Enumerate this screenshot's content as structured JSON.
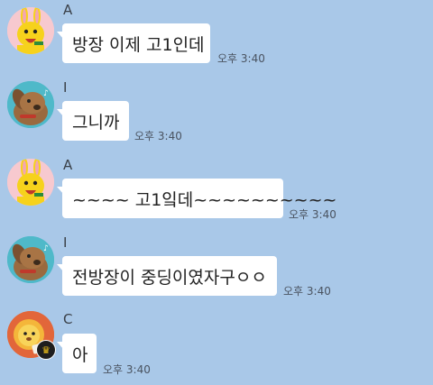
{
  "messages": [
    {
      "sender": "A",
      "text": "방장 이제 고1인데",
      "time": "오후 3:40",
      "avatar": "yellow-rabbit-icon"
    },
    {
      "sender": "I",
      "text": "그니까",
      "time": "오후 3:40",
      "avatar": "brown-dog-icon"
    },
    {
      "sender": "A",
      "text": "~~~~ 고1잌데~~~~~~~~~~",
      "time": "오후 3:40",
      "avatar": "yellow-rabbit-icon"
    },
    {
      "sender": "I",
      "text": "전방장이 중딩이였자구ㅇㅇ",
      "time": "오후 3:40",
      "avatar": "brown-dog-icon"
    },
    {
      "sender": "C",
      "text": "아",
      "time": "오후 3:40",
      "avatar": "lion-character-icon",
      "badge": "crown-icon"
    }
  ],
  "colors": {
    "background": "#a9c8e8",
    "bubble": "#ffffff",
    "crown": "#f5c518"
  }
}
